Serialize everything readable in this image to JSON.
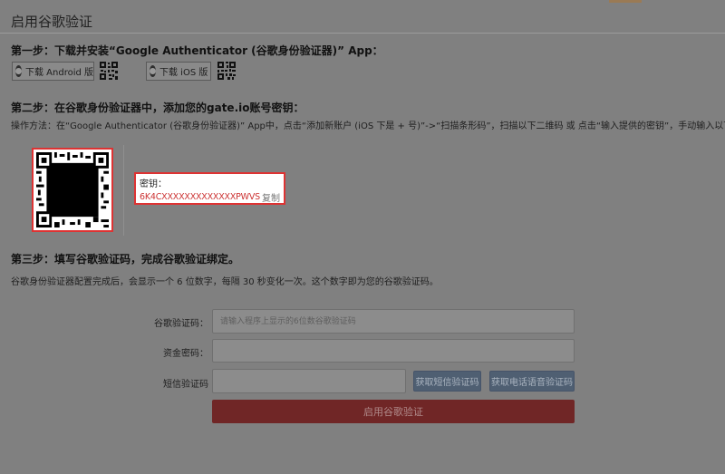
{
  "panel": {
    "title": "启用谷歌验证"
  },
  "step1": {
    "heading": "第一步：下载并安装“Google Authenticator (谷歌身份验证器)” App：",
    "android_label": "下载 Android 版",
    "ios_label": "下载 iOS 版"
  },
  "step2": {
    "heading": "第二步：在谷歌身份验证器中，添加您的gate.io账号密钥：",
    "instructions": "操作方法：在“Google Authenticator (谷歌身份验证器)” App中，点击“添加新账户 (iOS 下是 + 号)”->“扫描条形码”，扫描以下二维码 或 点击“输入提供的密钥”，手动输入以下密钥。",
    "secret_label": "密钥：",
    "secret_key": "6K4CXXXXXXXXXXXXXPWVS",
    "copy_label": "复制"
  },
  "step3": {
    "heading": "第三步：填写谷歌验证码，完成谷歌验证绑定。",
    "instructions": "谷歌身份验证器配置完成后，会显示一个 6 位数字，每隔 30 秒变化一次。这个数字即为您的谷歌验证码。"
  },
  "form": {
    "google_code_label": "谷歌验证码：",
    "google_code_value": "",
    "google_code_placeholder": "请输入程序上显示的6位数谷歌验证码",
    "fund_password_label": "资金密码：",
    "fund_password_value": "",
    "sms_code_label": "短信验证码",
    "sms_code_value": "",
    "get_sms_button": "获取短信验证码",
    "get_voice_button": "获取电话语音验证码",
    "submit_button": "启用谷歌验证"
  }
}
